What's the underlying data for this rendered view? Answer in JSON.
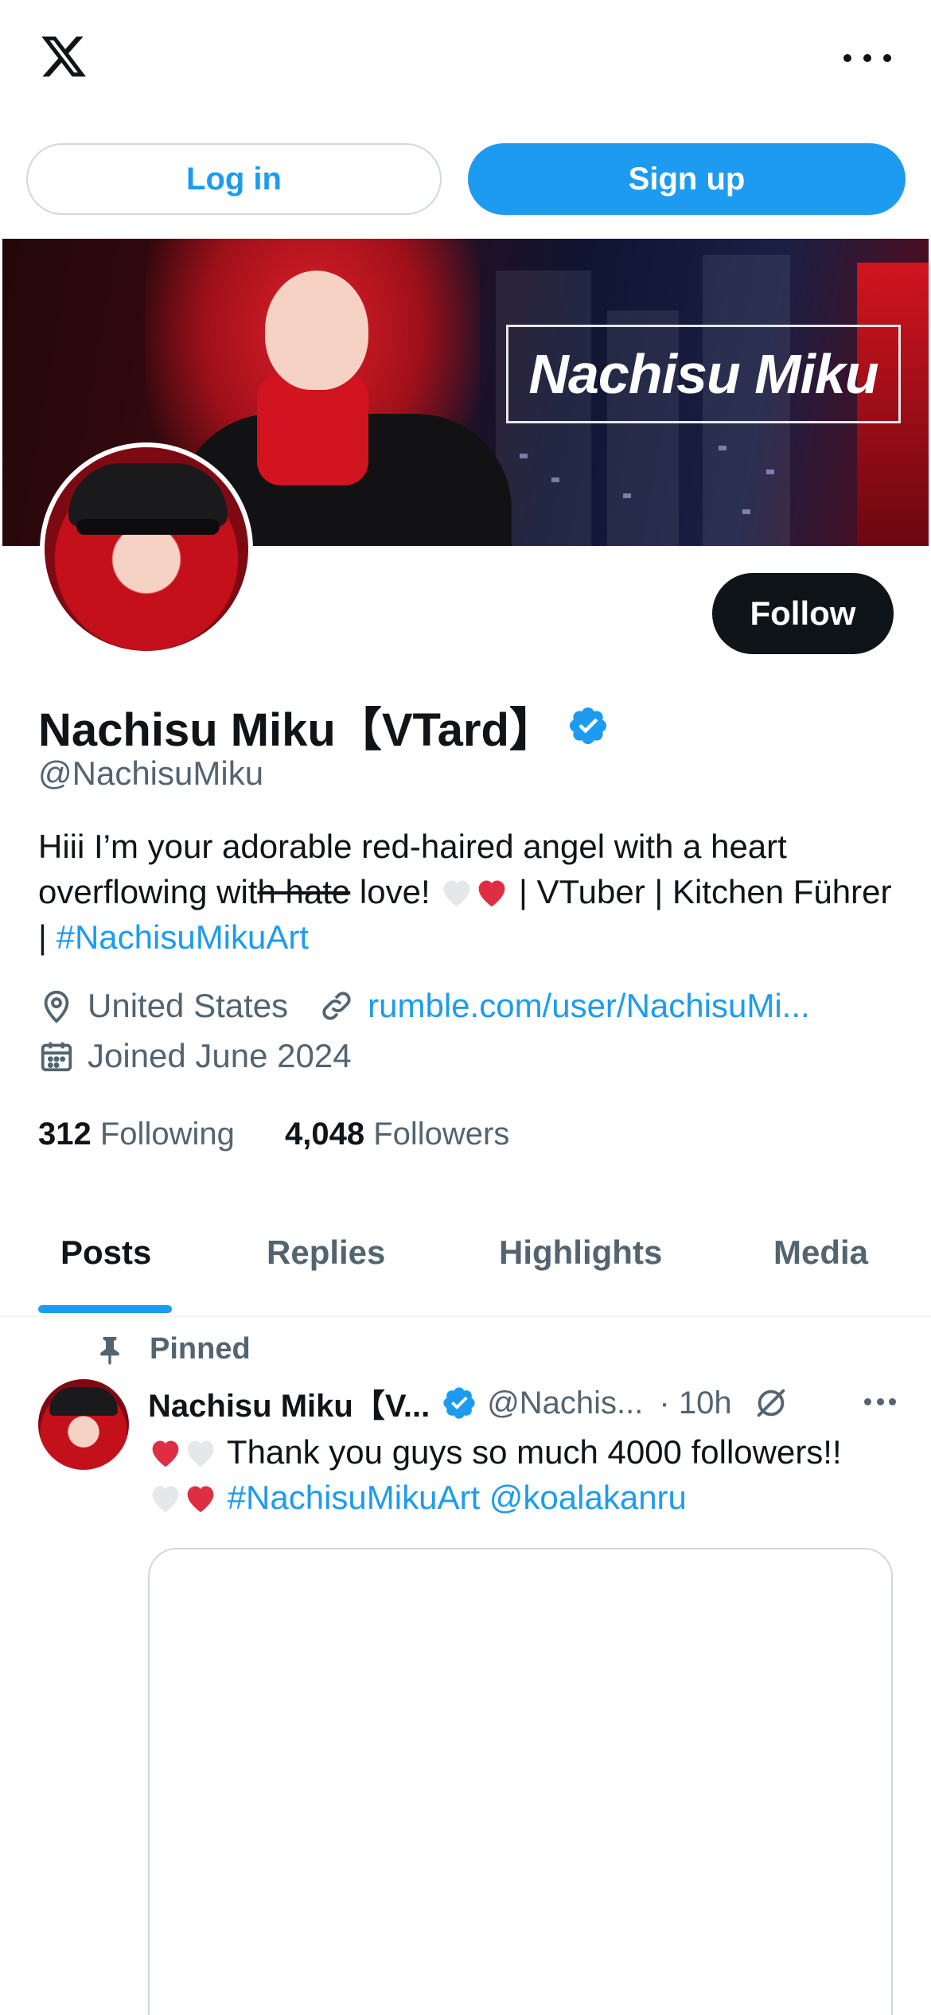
{
  "topbar": {
    "logo_icon": "x-logo-icon",
    "more_icon": "more-horizontal-icon"
  },
  "auth": {
    "login_label": "Log in",
    "signup_label": "Sign up"
  },
  "banner": {
    "title_text": "Nachisu Miku"
  },
  "profile": {
    "display_name": "Nachisu Miku【VTard】",
    "handle": "@NachisuMiku",
    "follow_label": "Follow",
    "bio": {
      "part1": "Hiii I’m your adorable red-haired angel with a heart overflowing wit",
      "strike": "h hate",
      "part2": " love! ",
      "part3": " | VTuber | Kitchen Führer | ",
      "hashtag": "#NachisuMikuArt"
    },
    "location": "United States",
    "website": "rumble.com/user/NachisuMi...",
    "joined": "Joined June 2024",
    "following_count": "312",
    "following_label": "Following",
    "followers_count": "4,048",
    "followers_label": "Followers"
  },
  "tabs": [
    {
      "label": "Posts",
      "active": true
    },
    {
      "label": "Replies",
      "active": false
    },
    {
      "label": "Highlights",
      "active": false
    },
    {
      "label": "Media",
      "active": false
    }
  ],
  "post": {
    "pinned_label": "Pinned",
    "author_name": "Nachisu Miku【V...",
    "author_handle": "@Nachis...",
    "time": "· 10h",
    "text_line1": " Thank you guys so much 4000 followers!!",
    "hashtag": "#NachisuMikuArt",
    "mention": "@koalakanru"
  },
  "colors": {
    "accent": "#1d9bf0",
    "text_primary": "#0f1419",
    "text_secondary": "#536471",
    "heart_red": "#dd2e44",
    "heart_white": "#e6e7e8"
  }
}
